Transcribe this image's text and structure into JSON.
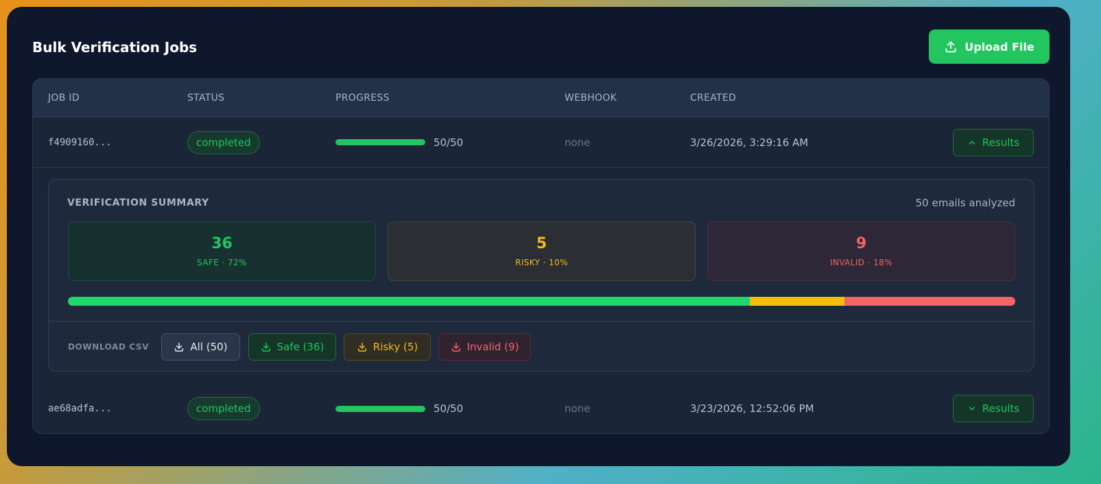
{
  "header": {
    "title": "Bulk Verification Jobs",
    "upload_label": "Upload File"
  },
  "table": {
    "columns": [
      "JOB ID",
      "STATUS",
      "PROGRESS",
      "WEBHOOK",
      "CREATED"
    ],
    "rows": [
      {
        "job_id": "f4909160...",
        "status": "completed",
        "progress_text": "50/50",
        "progress_fraction": 1.0,
        "webhook": "none",
        "created": "3/26/2026, 3:29:16 AM",
        "results_label": "Results",
        "expanded": true
      },
      {
        "job_id": "ae68adfa...",
        "status": "completed",
        "progress_text": "50/50",
        "progress_fraction": 1.0,
        "webhook": "none",
        "created": "3/23/2026, 12:52:06 PM",
        "results_label": "Results",
        "expanded": false
      }
    ]
  },
  "summary": {
    "title": "VERIFICATION SUMMARY",
    "count_text": "50 emails analyzed",
    "safe": {
      "value": "36",
      "label": "SAFE · 72%",
      "percent": 72
    },
    "risky": {
      "value": "5",
      "label": "RISKY · 10%",
      "percent": 10
    },
    "invalid": {
      "value": "9",
      "label": "INVALID · 18%",
      "percent": 18
    },
    "download_label": "DOWNLOAD CSV",
    "downloads": {
      "all": "All (50)",
      "safe": "Safe (36)",
      "risky": "Risky (5)",
      "invalid": "Invalid (9)"
    }
  },
  "colors": {
    "accent": "#22c55e",
    "safe": "#22c55e",
    "risky": "#f5b81b",
    "invalid": "#f26565",
    "panel": "#0e172b"
  },
  "icons": {
    "upload": "upload-icon",
    "download": "download-icon",
    "chevron_up": "chevron-up-icon",
    "chevron_down": "chevron-down-icon"
  }
}
